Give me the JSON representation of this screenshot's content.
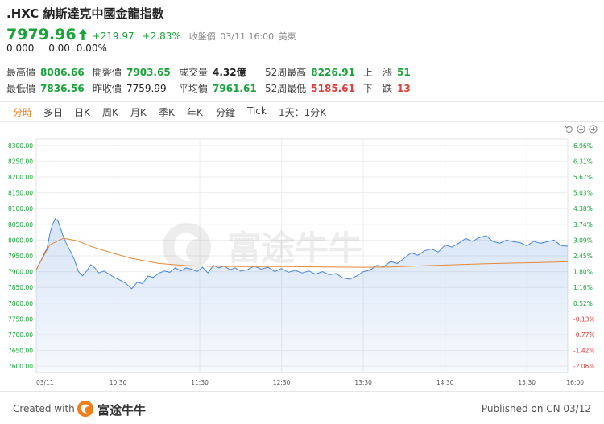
{
  "header": {
    "title": ".HXC 納斯達克中國金龍指數",
    "price": "7979.96",
    "change": "+219.97",
    "change_pct": "+2.83%",
    "status_label": "收盤價",
    "status_time": "03/11 16:00",
    "status_zone": "美東",
    "after_value": "0.000",
    "after_change": "0.00",
    "after_pct": "0.00%"
  },
  "stats": {
    "high_label": "最高價",
    "high": "8086.66",
    "low_label": "最低價",
    "low": "7836.56",
    "open_label": "開盤價",
    "open": "7903.65",
    "prev_close_label": "昨收價",
    "prev_close": "7759.99",
    "volume_label": "成交量",
    "volume": "4.32億",
    "avg_label": "平均價",
    "avg": "7961.61",
    "wk52_high_label": "52周最高",
    "wk52_high": "8226.91",
    "wk52_low_label": "52周最低",
    "wk52_low": "5185.61",
    "up_label": "上　漲",
    "up": "51",
    "down_label": "下　跌",
    "down": "13"
  },
  "tabs": [
    "分時",
    "多日",
    "日K",
    "周K",
    "月K",
    "季K",
    "年K",
    "分鐘",
    "Tick",
    "1天：1分K"
  ],
  "active_tab": 0,
  "colors": {
    "up": "#1aa33a",
    "down": "#e03b3b",
    "accent": "#f07e1b",
    "line": "#4a86d8",
    "avg_line": "#e5893a"
  },
  "icons": [
    "undo-icon",
    "zoom-out-icon",
    "zoom-in-icon"
  ],
  "watermark": "富途牛牛",
  "chart_data": {
    "type": "line",
    "x_ticks": [
      "03/11",
      "10:30",
      "11:30",
      "12:30",
      "13:30",
      "14:30",
      "15:30",
      "16:00"
    ],
    "y_ticks": [
      "8300.00",
      "8250.00",
      "8200.00",
      "8150.00",
      "8100.00",
      "8050.00",
      "8000.00",
      "7950.00",
      "7900.00",
      "7850.00",
      "7800.00",
      "7750.00",
      "7700.00",
      "7650.00",
      "7600.00"
    ],
    "pct_ticks": [
      "6.96%",
      "6.31%",
      "5.67%",
      "5.03%",
      "4.38%",
      "3.74%",
      "3.09%",
      "2.45%",
      "1.80%",
      "1.16%",
      "0.52%",
      "-0.13%",
      "-0.77%",
      "-1.42%",
      "-2.06%"
    ],
    "ylim": [
      7580,
      8320
    ],
    "x_minutes": [
      0,
      390
    ],
    "series": [
      {
        "x": [
          0,
          4,
          8,
          10,
          12,
          14,
          16,
          18,
          20,
          22,
          25,
          28,
          31,
          34,
          37,
          40,
          43,
          46,
          50,
          54,
          58,
          62,
          66,
          70,
          74,
          78,
          82,
          86,
          90,
          94,
          98,
          102,
          106,
          110,
          114,
          118,
          122,
          126,
          130,
          134,
          138,
          142,
          146,
          150,
          155,
          160,
          165,
          170,
          175,
          180,
          185,
          190,
          195,
          200,
          205,
          210,
          215,
          220,
          225,
          230,
          235,
          240,
          245,
          250,
          255,
          260,
          265,
          270,
          275,
          280,
          285,
          290,
          295,
          300,
          305,
          310,
          315,
          320,
          325,
          330,
          335,
          340,
          345,
          350,
          355,
          360,
          365,
          370,
          375,
          380,
          385,
          390
        ],
        "y": [
          7906,
          7940,
          7975,
          8020,
          8050,
          8068,
          8060,
          8035,
          8010,
          7990,
          7965,
          7938,
          7900,
          7887,
          7902,
          7922,
          7912,
          7896,
          7902,
          7890,
          7880,
          7872,
          7862,
          7846,
          7866,
          7862,
          7886,
          7882,
          7895,
          7902,
          7898,
          7912,
          7902,
          7912,
          7908,
          7900,
          7914,
          7896,
          7920,
          7912,
          7918,
          7906,
          7912,
          7902,
          7906,
          7918,
          7908,
          7914,
          7900,
          7910,
          7898,
          7904,
          7896,
          7902,
          7892,
          7900,
          7890,
          7894,
          7880,
          7876,
          7886,
          7900,
          7905,
          7920,
          7916,
          7932,
          7926,
          7942,
          7960,
          7952,
          7966,
          7972,
          7962,
          7984,
          7978,
          7990,
          8005,
          7996,
          8008,
          8014,
          7996,
          7990,
          8000,
          7995,
          7992,
          7982,
          7996,
          7990,
          7995,
          8000,
          7982,
          7981
        ]
      },
      {
        "x": [
          0,
          10,
          20,
          30,
          40,
          55,
          70,
          90,
          110,
          130,
          150,
          180,
          210,
          240,
          260,
          280,
          300,
          330,
          360,
          390
        ],
        "y": [
          7906,
          7985,
          8006,
          7998,
          7980,
          7960,
          7942,
          7926,
          7919,
          7917,
          7916,
          7916,
          7915,
          7914,
          7915,
          7918,
          7921,
          7925,
          7928,
          7931
        ]
      }
    ]
  }
}
